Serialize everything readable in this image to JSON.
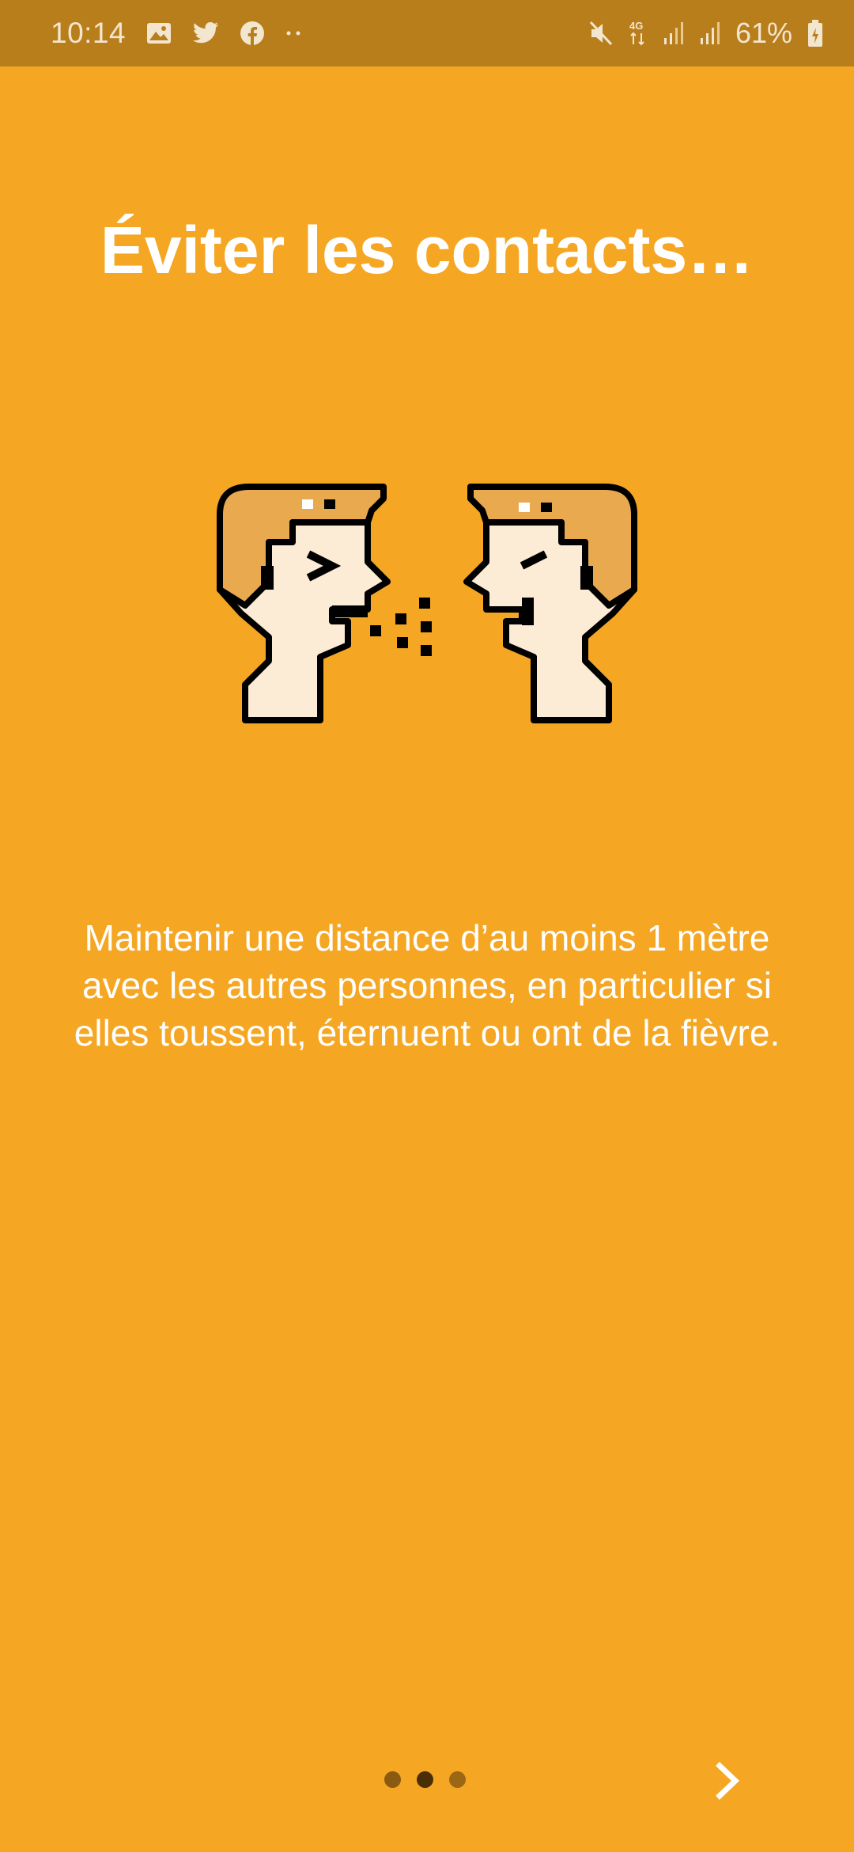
{
  "status_bar": {
    "time": "10:14",
    "battery_percent": "61%",
    "network": "4G",
    "left_icons": [
      "gallery-icon",
      "twitter-icon",
      "facebook-icon",
      "more-dots-icon"
    ],
    "right_icons": [
      "mute-icon",
      "network-4g-icon",
      "signal-icon",
      "signal-icon",
      "battery-charging-icon"
    ]
  },
  "onboarding": {
    "title": "Éviter les contacts…",
    "illustration": "two-heads-sneeze-icon",
    "description": "Maintenir une distance d’au moins 1 mètre avec les autres personnes, en particulier si elles toussent, éternuent ou ont de la fièvre.",
    "page_indicator": {
      "total": 3,
      "current": 2
    },
    "next_icon": "chevron-right-icon"
  },
  "colors": {
    "background": "#f5a623",
    "status_bar": "#b97e1c",
    "text": "#ffffff",
    "dot_active": "#4a2e05",
    "dot_inactive": "#8a5a10"
  }
}
